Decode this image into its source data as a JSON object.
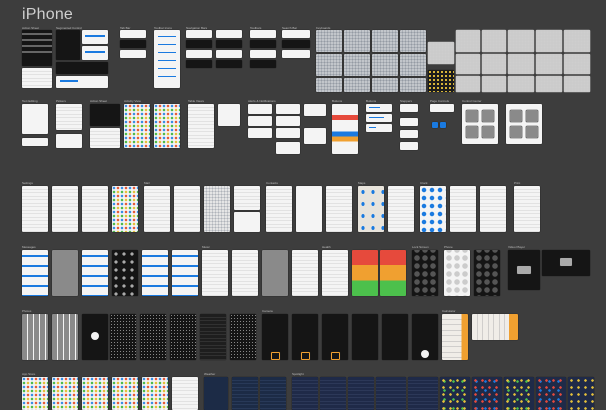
{
  "title": "iPhone",
  "sections": {
    "action_sheet": "Action Sheet",
    "segmented_control": "Segmented Control",
    "tab_bar": "Tab Bar",
    "toolbar_icons": "Toolbar Icons",
    "navigation_bars": "Navigation Bars",
    "toolbars": "Toolbars",
    "search_bar": "Search Bar",
    "keyboards": "Keyboards",
    "text_editing": "Text Editing",
    "pickers": "Pickers",
    "activity_view": "Activity View",
    "table_views": "Table Views",
    "alerts": "Alerts & Notifications",
    "buttons": "Buttons",
    "steppers": "Steppers",
    "page_controls": "Page Controls",
    "control_center": "Control Center",
    "settings": "Settings",
    "mail": "Mail",
    "contacts": "Contacts",
    "maps": "Maps",
    "clock": "Clock",
    "print": "Print",
    "messages": "Messages",
    "music": "Music",
    "health": "Health",
    "lock_screen": "Lock Screen",
    "phone": "Phone",
    "video_player": "Video Player",
    "photos": "Photos",
    "camera": "Camera",
    "calculator": "Calculator",
    "app_store": "App Store",
    "weather": "Weather",
    "spotlight": "Spotlight"
  },
  "colors": {
    "background": "#3d3d3d",
    "accent_blue": "#1a7ae0",
    "health_red": "#e64a3c",
    "health_orange": "#f0a030",
    "health_green": "#4cc04c",
    "calc_orange": "#f0a030"
  }
}
